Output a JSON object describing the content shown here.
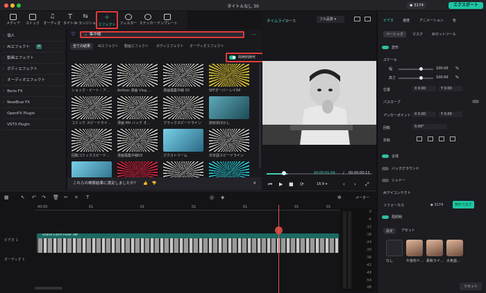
{
  "window": {
    "title": "タイトルなし 30",
    "credits": "3174",
    "export_label": "エクスポート"
  },
  "toolbar": [
    {
      "label": "メディア",
      "icon": "media-icon"
    },
    {
      "label": "ストック",
      "icon": "stock-icon"
    },
    {
      "label": "オーディオ",
      "icon": "music-note-icon"
    },
    {
      "label": "タイトル",
      "icon": "title-t-icon"
    },
    {
      "label": "トランジション",
      "icon": "transition-icon"
    },
    {
      "label": "エフェクト",
      "icon": "effect-icon"
    },
    {
      "label": "フィルター",
      "icon": "filter-icon"
    },
    {
      "label": "ステッカー",
      "icon": "sticker-icon"
    },
    {
      "label": "テンプレート",
      "icon": "template-icon"
    }
  ],
  "sidebar": {
    "items": [
      {
        "label": "個人"
      },
      {
        "label": "AIエフェクト",
        "badge": "AI"
      },
      {
        "label": "動画エフェクト"
      },
      {
        "label": "ボディエフェクト"
      },
      {
        "label": "オーディオエフェクト"
      },
      {
        "label": "Boris FX"
      },
      {
        "label": "NewBlue FX"
      },
      {
        "label": "OpenFX Plugin"
      },
      {
        "label": "VST3 Plugin"
      }
    ]
  },
  "browser": {
    "search_value": "集中線",
    "filters": [
      "全ての結果",
      "AIエフェクト",
      "動画エフェクト",
      "ボディエフェクト",
      "オーディオエフェクト"
    ],
    "commercial_label": "商用利用可",
    "thumbnails": [
      {
        "name": "ショック・イート・ア…",
        "style": "burst"
      },
      {
        "name": "Anthon 漫画 Vlog …",
        "style": "burst"
      },
      {
        "name": "漫画風集中線 03",
        "style": "burst"
      },
      {
        "name": "SFFオーバーレイ04",
        "style": "burst-yellow"
      },
      {
        "name": "コミック スピードライ…",
        "style": "burst"
      },
      {
        "name": "漫画 MV バック オ…",
        "style": "burst"
      },
      {
        "name": "ブラックスピードライン",
        "style": "burst"
      },
      {
        "name": "放射状ぼかし",
        "style": "photo"
      },
      {
        "name": "回転コミックスピード…",
        "style": "burst"
      },
      {
        "name": "漫画風集中線03",
        "style": "burst"
      },
      {
        "name": "ズクストリーム",
        "style": "photo-b"
      },
      {
        "name": "日本語スピードライン",
        "style": "burst"
      },
      {
        "name": "",
        "style": "photo-b"
      },
      {
        "name": "",
        "style": "burst-red"
      },
      {
        "name": "",
        "style": "burst"
      },
      {
        "name": "",
        "style": "burst-cyan"
      }
    ],
    "feedback": "これらの検索結果に満足しましたか？"
  },
  "preview": {
    "tabs": [
      "タイムライン",
      "ソース"
    ],
    "quality": "フル品質",
    "current_time": "00:00:01:04",
    "separator": "/",
    "total_time": "00:00:00:12",
    "ratio": "16:9"
  },
  "props": {
    "tabs": [
      "ビデオ",
      "速度",
      "アニメーション",
      "色"
    ],
    "subtabs": [
      "ベーシック",
      "マスク",
      "AIマットツール"
    ],
    "transform_label": "変形",
    "scale_label": "スケール",
    "width_label": "幅",
    "height_label": "高さ",
    "width_value": "100.00",
    "height_value": "100.00",
    "percent": "%",
    "position_label": "位置",
    "pos_x": "0.00",
    "pos_y": "0.00",
    "pathcurve_label": "パスカーブ",
    "anchor_label": "アンカーポイント",
    "anchor_x": "0.00",
    "anchor_y": "0.00",
    "rotate_label": "回転",
    "rotate_value": "0.00°",
    "flip_label": "反転",
    "composite_label": "合成",
    "background_label": "バックグラウンド",
    "shadow_label": "シャドー",
    "ai_icon_label": "AIアイコンテクト",
    "refocus_label": "リフォーカス",
    "refocus_credits": "3174",
    "refocus_trial": "無料で試す",
    "face_label": "再照明",
    "preset_tabs": [
      "設定",
      "アセット"
    ],
    "presets": [
      "なし",
      "午後秒ド…",
      "柔和ライ…",
      "大気遊…"
    ],
    "reset_label": "リセット"
  },
  "timeline": {
    "ruler": [
      "00:00",
      "01",
      "01",
      "01",
      "01",
      "01",
      "01"
    ],
    "clip_name": "Grand Cutch Fever 18f",
    "track_video": "ビデオ 1",
    "track_audio": "オーディオ 1",
    "meter_label": "メーター",
    "meter_ticks": [
      "0",
      "-6",
      "-12",
      "-18",
      "-24",
      "-30",
      "-36",
      "-42",
      "-48",
      "-54"
    ],
    "meter_unit": "dB"
  }
}
